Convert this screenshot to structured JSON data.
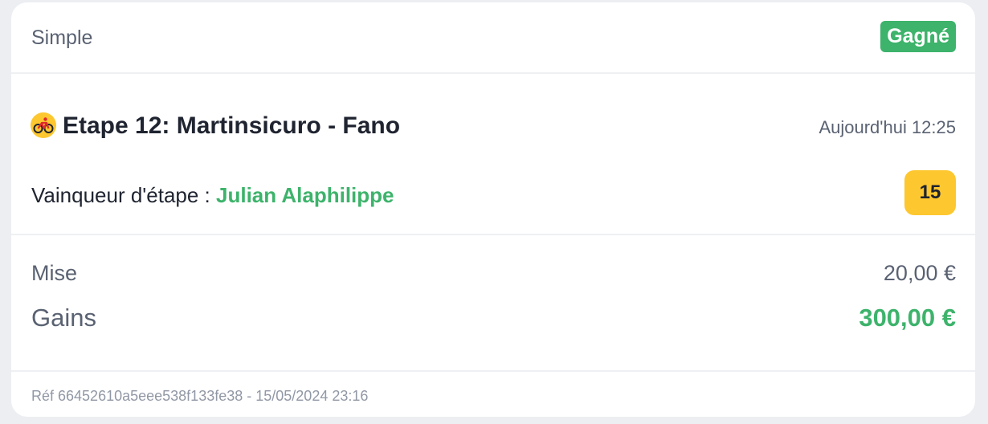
{
  "bet": {
    "type": "Simple",
    "status": "Gagné"
  },
  "event": {
    "icon": "cycling-icon",
    "title": "Etape 12: Martinsicuro - Fano",
    "time": "Aujourd'hui 12:25"
  },
  "selection": {
    "market_label": "Vainqueur d'étape :",
    "value": "Julian Alaphilippe",
    "odds": "15"
  },
  "summary": {
    "stake_label": "Mise",
    "stake_value": "20,00 €",
    "gains_label": "Gains",
    "gains_value": "300,00 €"
  },
  "footer": {
    "reference": "Réf 66452610a5eee538f133fe38 - 15/05/2024 23:16"
  },
  "colors": {
    "win_green": "#3db36b",
    "odds_yellow": "#fdc72f",
    "text_dark": "#1f2430",
    "text_muted": "#5a6272"
  }
}
